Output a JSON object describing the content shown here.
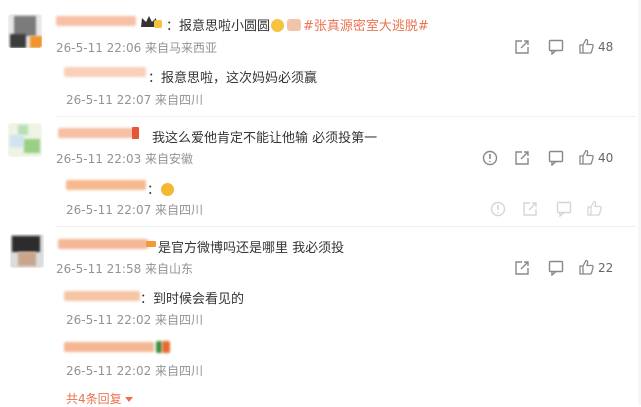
{
  "comments": [
    {
      "text_before": "：报意思啦小圆圆",
      "hashtag": "#张真源密室大逃脱#",
      "time": "26-5-11 22:06 来自马来西亚",
      "like_count": "48",
      "replies": [
        {
          "text": "：报意思啦，这次妈妈必须赢",
          "time": "26-5-11 22:07 来自四川"
        }
      ]
    },
    {
      "text": "我这么爱他肯定不能让他输 必须投第一",
      "time": "26-5-11 22:03 来自安徽",
      "like_count": "40",
      "replies": [
        {
          "text": "：",
          "time": "26-5-11 22:07 来自四川"
        }
      ]
    },
    {
      "text": "是官方微博吗还是哪里 我必须投",
      "time": "26-5-11 21:58 来自山东",
      "like_count": "22",
      "replies": [
        {
          "text": "：到时候会看见的",
          "time": "26-5-11 22:02 来自四川"
        },
        {
          "text": "",
          "time": "26-5-11 22:02 来自四川"
        }
      ],
      "more_replies": "共4条回复"
    }
  ],
  "icons": {
    "report": "report-icon",
    "share": "share-icon",
    "comment": "comment-icon",
    "like": "like-icon",
    "expand": "triangle-down-icon"
  },
  "colors": {
    "accent": "#eb7350",
    "meta": "#939393",
    "text": "#333333"
  }
}
